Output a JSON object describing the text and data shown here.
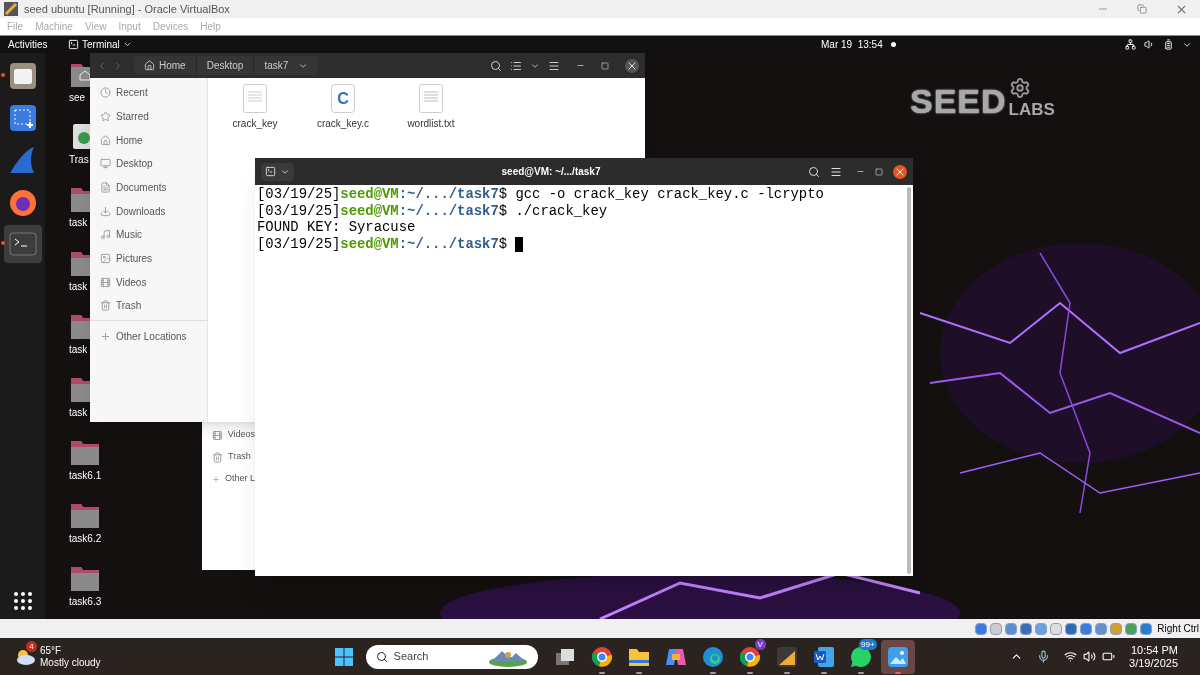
{
  "vbox": {
    "title": "seed ubuntu [Running] - Oracle VirtualBox",
    "menu": [
      {
        "label": "File",
        "disabled": true
      },
      {
        "label": "Machine",
        "disabled": true
      },
      {
        "label": "View",
        "disabled": true
      },
      {
        "label": "Input",
        "disabled": true
      },
      {
        "label": "Devices",
        "disabled": true
      },
      {
        "label": "Help",
        "disabled": true
      }
    ],
    "host_key": "Right Ctrl"
  },
  "topbar": {
    "activities": "Activities",
    "app": "Terminal",
    "clock": "Mar 19  13:54"
  },
  "dock": [
    {
      "kind": "files",
      "running": true,
      "selected": false
    },
    {
      "kind": "screenshot",
      "running": false,
      "selected": false
    },
    {
      "kind": "shark",
      "running": false,
      "selected": false
    },
    {
      "kind": "firefox",
      "running": false,
      "selected": false
    },
    {
      "kind": "terminal",
      "running": true,
      "selected": true
    }
  ],
  "desktop_icons": [
    {
      "kind": "home",
      "label": "see"
    },
    {
      "kind": "trash",
      "label": "Tras"
    },
    {
      "kind": "folder",
      "label": "task"
    },
    {
      "kind": "folder",
      "label": "task"
    },
    {
      "kind": "folder",
      "label": "task"
    },
    {
      "kind": "folder",
      "label": "task"
    },
    {
      "kind": "folder",
      "label": "task6.1"
    },
    {
      "kind": "folder",
      "label": "task6.2"
    },
    {
      "kind": "folder",
      "label": "task6.3"
    }
  ],
  "logo": {
    "word": "SEED",
    "sub": "LABS"
  },
  "files_window": {
    "path": [
      "Home",
      "Desktop",
      "task7"
    ],
    "sidebar": [
      {
        "kind": "recent",
        "label": "Recent"
      },
      {
        "kind": "starred",
        "label": "Starred"
      },
      {
        "kind": "home",
        "label": "Home"
      },
      {
        "kind": "desktop",
        "label": "Desktop"
      },
      {
        "kind": "documents",
        "label": "Documents"
      },
      {
        "kind": "downloads",
        "label": "Downloads"
      },
      {
        "kind": "music",
        "label": "Music"
      },
      {
        "kind": "pictures",
        "label": "Pictures"
      },
      {
        "kind": "videos",
        "label": "Videos"
      },
      {
        "kind": "trash",
        "label": "Trash"
      },
      {
        "kind": "other",
        "label": "Other Locations"
      }
    ],
    "files": [
      {
        "kind": "binary",
        "name": "crack_key"
      },
      {
        "kind": "source",
        "name": "crack_key.c",
        "glyph": "C"
      },
      {
        "kind": "text",
        "name": "wordlist.txt"
      }
    ]
  },
  "back_window": {
    "sidebar": [
      {
        "kind": "videos",
        "label": "Videos"
      },
      {
        "kind": "trash",
        "label": "Trash"
      },
      {
        "kind": "other",
        "label": "Other L"
      }
    ]
  },
  "terminal": {
    "title": "seed@VM: ~/.../task7",
    "lines": [
      {
        "kind": "prompt",
        "stamp": "[03/19/25]",
        "user": "seed@VM",
        "path": ":~/.../task7",
        "sign": "$ ",
        "command": "gcc -o crack_key crack_key.c -lcrypto",
        "cursor": false
      },
      {
        "kind": "prompt",
        "stamp": "[03/19/25]",
        "user": "seed@VM",
        "path": ":~/.../task7",
        "sign": "$ ",
        "command": "./crack_key",
        "cursor": false
      },
      {
        "kind": "output",
        "text": "FOUND KEY: Syracuse"
      },
      {
        "kind": "prompt",
        "stamp": "[03/19/25]",
        "user": "seed@VM",
        "path": ":~/.../task7",
        "sign": "$ ",
        "cursor": true
      }
    ]
  },
  "taskbar": {
    "weather": {
      "badge": "4",
      "temp": "65°F",
      "summary": "Mostly cloudy"
    },
    "search": "Search",
    "apps": [
      {
        "kind": "taskview",
        "running": false,
        "selected": false
      },
      {
        "kind": "chrome",
        "running": true,
        "selected": false
      },
      {
        "kind": "explorer",
        "running": true,
        "selected": false
      },
      {
        "kind": "copilot",
        "running": false,
        "selected": false
      },
      {
        "kind": "edge",
        "running": true,
        "selected": false
      },
      {
        "kind": "chrome",
        "badge": "V",
        "running": true,
        "selected": false
      },
      {
        "kind": "app",
        "running": true,
        "selected": false
      },
      {
        "kind": "word",
        "running": true,
        "selected": false
      },
      {
        "kind": "whatsapp",
        "badge": "99+",
        "running": true,
        "selected": false
      },
      {
        "kind": "photos",
        "running": true,
        "selected": true
      }
    ],
    "time": "10:54 PM",
    "date": "3/19/2025"
  }
}
